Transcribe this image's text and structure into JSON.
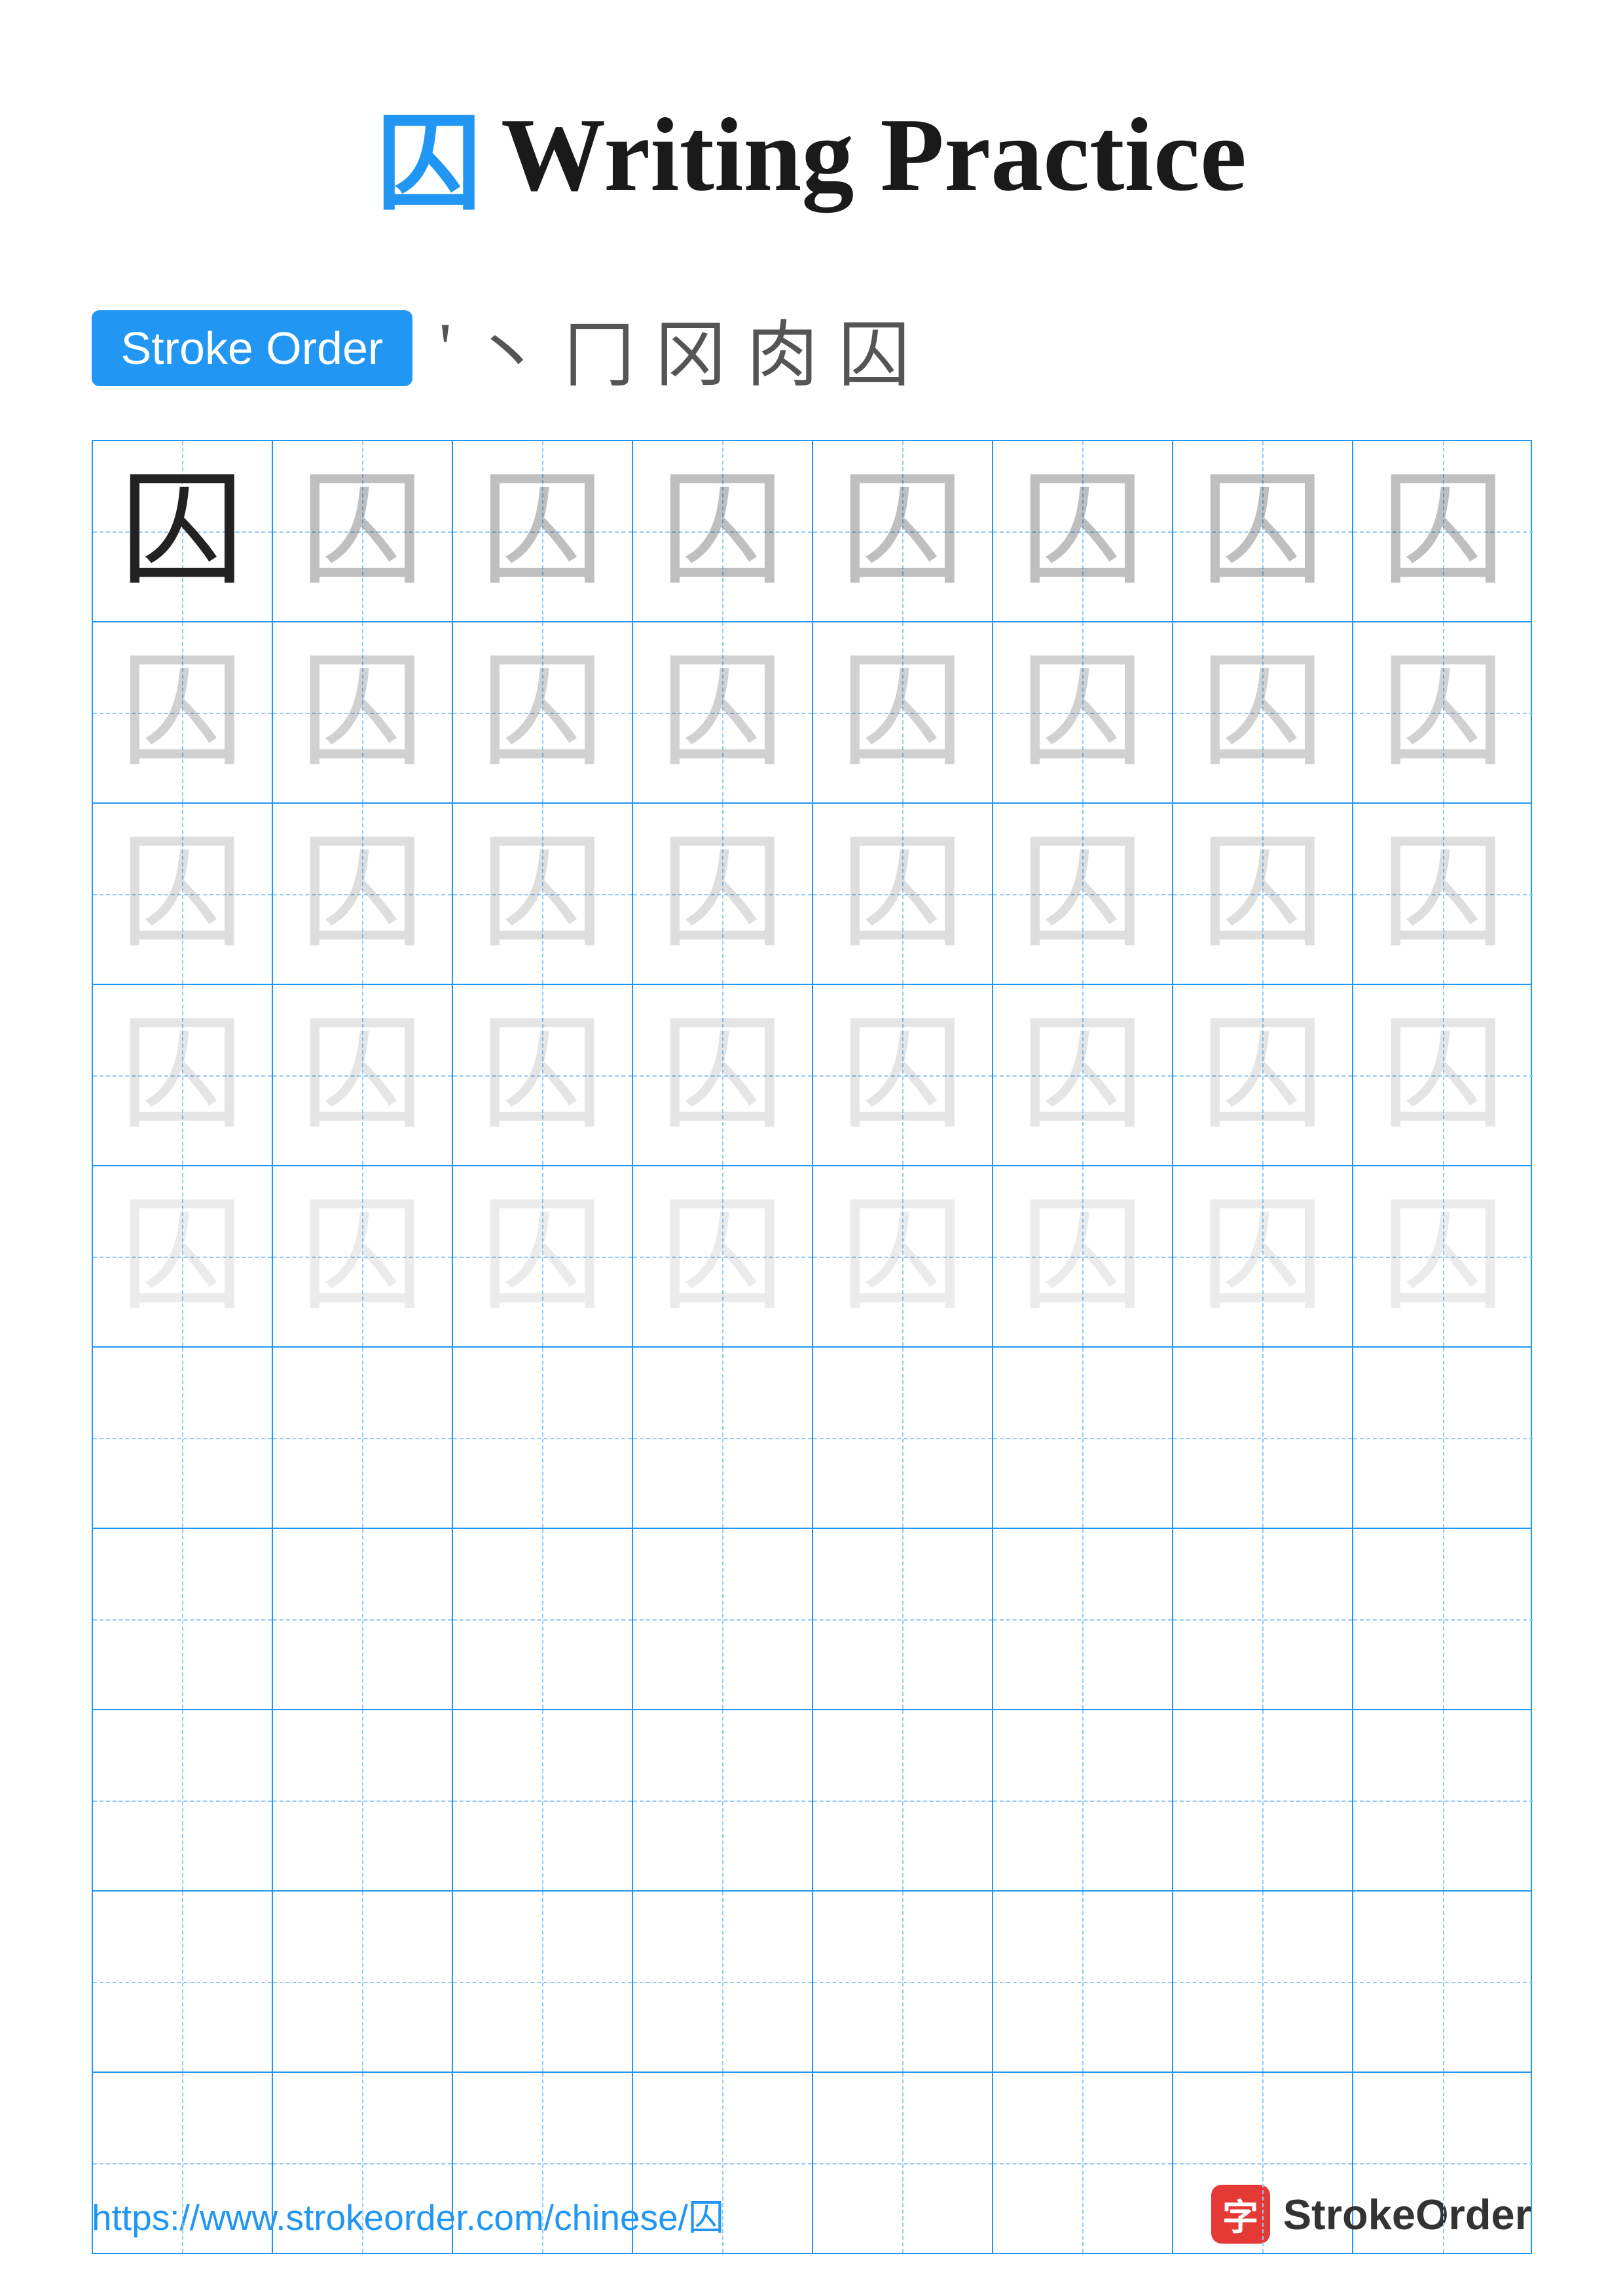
{
  "page": {
    "title_char": "囚",
    "title_text": "Writing Practice",
    "stroke_order_label": "Stroke Order",
    "stroke_order_chars": [
      "'",
      "ㄣ",
      "冂",
      "冈",
      "肉",
      "囚"
    ],
    "practice_char": "囚",
    "footer_url": "https://www.strokeorder.com/chinese/囚",
    "brand_name": "StrokeOrder",
    "brand_icon_char": "字"
  },
  "grid": {
    "cols": 8,
    "rows": 10,
    "char_rows": 5,
    "empty_rows": 5
  }
}
